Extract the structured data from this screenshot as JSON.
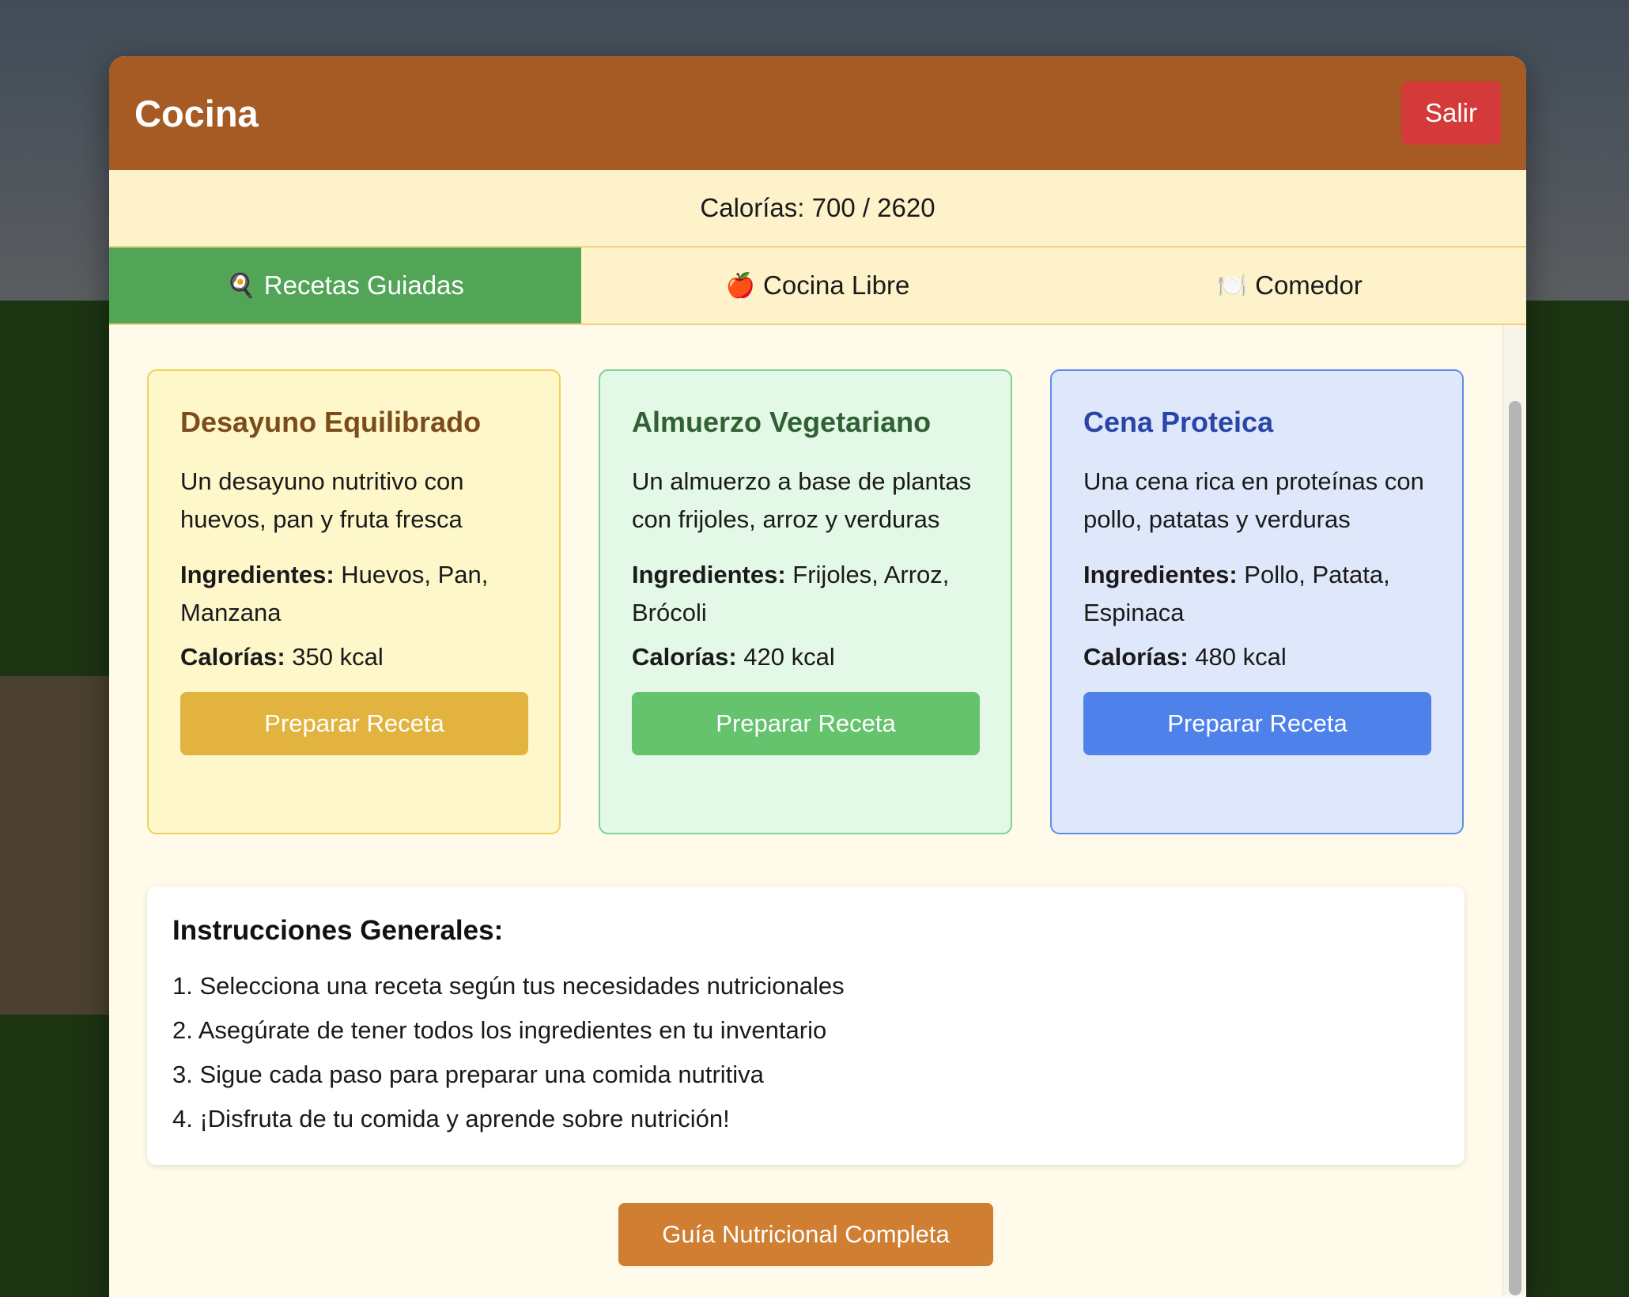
{
  "modal": {
    "title": "Cocina",
    "exit_label": "Salir"
  },
  "calories": {
    "label": "Calorías: 700 / 2620"
  },
  "tabs": [
    {
      "icon": "🍳",
      "label": "Recetas Guiadas",
      "active": true
    },
    {
      "icon": "🍎",
      "label": "Cocina Libre",
      "active": false
    },
    {
      "icon": "🍽️",
      "label": "Comedor",
      "active": false
    }
  ],
  "recipes": [
    {
      "title": "Desayuno Equilibrado",
      "description": "Un desayuno nutritivo con huevos, pan y fruta fresca",
      "ingredients_label": "Ingredientes:",
      "ingredients": "Huevos, Pan, Manzana",
      "calories_label": "Calorías:",
      "calories": "350 kcal",
      "button": "Preparar Receta",
      "accent": "#e2b43f"
    },
    {
      "title": "Almuerzo Vegetariano",
      "description": "Un almuerzo a base de plantas con frijoles, arroz y verduras",
      "ingredients_label": "Ingredientes:",
      "ingredients": "Frijoles, Arroz, Brócoli",
      "calories_label": "Calorías:",
      "calories": "420 kcal",
      "button": "Preparar Receta",
      "accent": "#64c36c"
    },
    {
      "title": "Cena Proteica",
      "description": "Una cena rica en proteínas con pollo, patatas y verduras",
      "ingredients_label": "Ingredientes:",
      "ingredients": "Pollo, Patata, Espinaca",
      "calories_label": "Calorías:",
      "calories": "480 kcal",
      "button": "Preparar Receta",
      "accent": "#4e81ea"
    }
  ],
  "instructions": {
    "title": "Instrucciones Generales:",
    "steps": [
      "1. Selecciona una receta según tus necesidades nutricionales",
      "2. Asegúrate de tener todos los ingredientes en tu inventario",
      "3. Sigue cada paso para preparar una comida nutritiva",
      "4. ¡Disfruta de tu comida y aprende sobre nutrición!"
    ]
  },
  "guide_button": "Guía Nutricional Completa",
  "colors": {
    "header": "#a65a24",
    "exit": "#d43a3a",
    "active_tab": "#52a457",
    "guide": "#cf7e32"
  }
}
